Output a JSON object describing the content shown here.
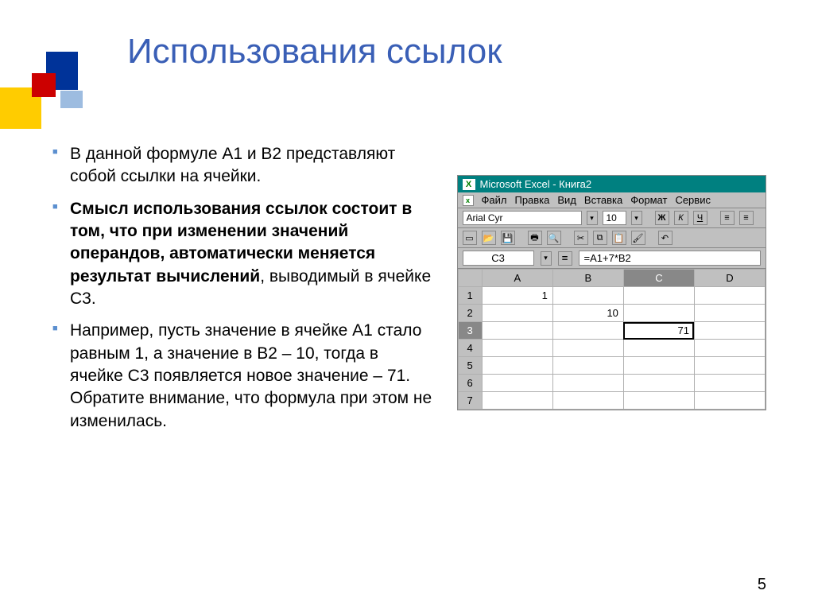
{
  "title": "Использования ссылок",
  "bullets": [
    {
      "text": "В данной формуле А1 и В2 представляют собой ссылки на ячейки.",
      "bold": false
    },
    {
      "text_before": "",
      "bold_text": "Смысл использования ссылок состоит в том, что при изменении значений операндов, автоматически меняется результат вычислений",
      "text_after": ", выводимый в ячейке С3."
    },
    {
      "text": "Например, пусть значение в ячейке А1 стало равным 1, а значение в В2 – 10, тогда в ячейке С3 появляется новое значение – 71. Обратите внимание, что формула при этом не изменилась.",
      "bold": false
    }
  ],
  "excel": {
    "title": "Microsoft Excel - Книга2",
    "menu": [
      "Файл",
      "Правка",
      "Вид",
      "Вставка",
      "Формат",
      "Сервис"
    ],
    "font_name": "Arial Cyr",
    "font_size": "10",
    "namebox": "C3",
    "formula": "=A1+7*B2",
    "columns": [
      "A",
      "B",
      "C",
      "D"
    ],
    "rows": [
      "1",
      "2",
      "3",
      "4",
      "5",
      "6",
      "7"
    ],
    "cells": {
      "A1": "1",
      "B2": "10",
      "C3": "71"
    },
    "selected_cell": "C3"
  },
  "page_number": "5",
  "fmt": {
    "bold": "Ж",
    "italic": "К",
    "underline": "Ч"
  }
}
